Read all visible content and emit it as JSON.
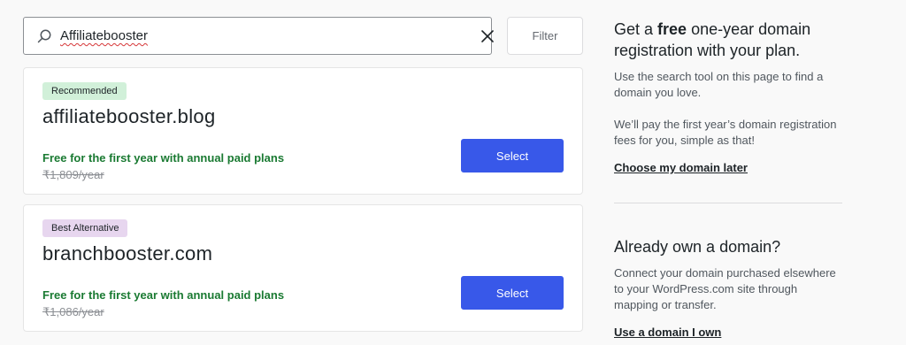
{
  "search": {
    "value": "Affiliatebooster",
    "filter_label": "Filter"
  },
  "results": [
    {
      "badge": "Recommended",
      "domain": "affiliatebooster.blog",
      "free_note": "Free for the first year with annual paid plans",
      "old_price": "₹1,809/year",
      "select_label": "Select"
    },
    {
      "badge": "Best Alternative",
      "domain": "branchbooster.com",
      "free_note": "Free for the first year with annual paid plans",
      "old_price": "₹1,086/year",
      "select_label": "Select"
    }
  ],
  "sidebar": {
    "free_heading_pre": "Get a ",
    "free_heading_bold": "free",
    "free_heading_post": " one-year domain registration with your plan.",
    "free_text_1": "Use the search tool on this page to find a domain you love.",
    "free_text_2": "We’ll pay the first year’s domain registration fees for you, simple as that!",
    "choose_later_link": "Choose my domain later",
    "own_heading": "Already own a domain?",
    "own_text": "Connect your domain purchased elsewhere to your WordPress.com site through mapping or transfer.",
    "own_link": "Use a domain I own"
  },
  "colors": {
    "accent": "#3858e9",
    "free_green": "#1a7a32",
    "recommended_badge": "#d1f0d9",
    "alternative_badge": "#e7d6ef"
  },
  "icons": {
    "search": "search-icon",
    "clear": "close-icon"
  }
}
